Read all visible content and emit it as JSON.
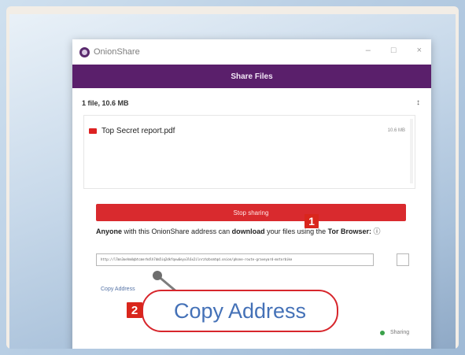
{
  "window": {
    "title": "OnionShare",
    "controls": [
      "–",
      "□",
      "×"
    ]
  },
  "header": {
    "title": "Share Files"
  },
  "files": {
    "summary": "1 file, 10.6 MB",
    "toggle": "↕",
    "items": [
      {
        "name": "Top Secret report.pdf",
        "size": "10.6 MB"
      }
    ]
  },
  "actions": {
    "stop_sharing": "Stop sharing",
    "copy_address": "Copy Address"
  },
  "info": {
    "part1": "Anyone",
    "part2": " with this OnionShare address can ",
    "part3": "download",
    "part4": " your files using the ",
    "part5": "Tor Browser:",
    "help": " ⓘ"
  },
  "address": {
    "value": "http://l7mn3oehm4qbtcmerhdlh7dm5iq2dkfqvw6eyx3l6x2ilnrzhzbsmtqd.onion/phone-route-graveyard-motorbike"
  },
  "annotations": {
    "badge_1": "1",
    "badge_2": "2",
    "callout_text": "Copy Address"
  },
  "status": {
    "text": "Sharing",
    "color": "#3aa14a"
  },
  "colors": {
    "accent": "#5a1f6b",
    "stop": "#d92a2e",
    "badge": "#d9261c",
    "link": "#4471b7"
  },
  "icons": [
    "onionshare-logo-icon",
    "pdf-file-icon",
    "mouse-cursor-icon",
    "status-dot-icon"
  ]
}
